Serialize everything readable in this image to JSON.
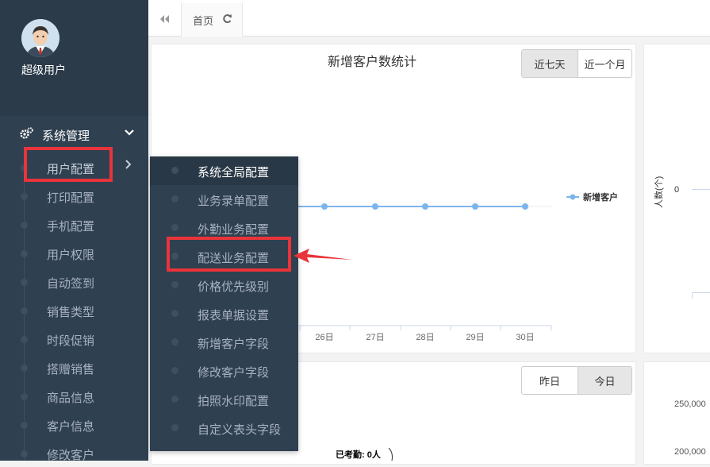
{
  "profile": {
    "name": "超级用户"
  },
  "nav": {
    "section": "系统管理",
    "items": [
      "用户配置",
      "打印配置",
      "手机配置",
      "用户权限",
      "自动签到",
      "销售类型",
      "时段促销",
      "搭赠销售",
      "商品信息",
      "客户信息",
      "修改客户"
    ]
  },
  "submenu": {
    "items": [
      "系统全局配置",
      "业务录单配置",
      "外勤业务配置",
      "配送业务配置",
      "价格优先级别",
      "报表单据设置",
      "新增客户字段",
      "修改客户字段",
      "拍照水印配置",
      "自定义表头字段"
    ]
  },
  "tabs": {
    "home": "首页"
  },
  "chart1": {
    "title": "新增客户数统计",
    "btn_week": "近七天",
    "btn_month": "近一个月",
    "legend": "新增客户",
    "x_labels": [
      "26日",
      "27日",
      "28日",
      "29日",
      "30日"
    ]
  },
  "chart_data": {
    "type": "line",
    "title": "新增客户数统计",
    "categories": [
      "26日",
      "27日",
      "28日",
      "29日",
      "30日"
    ],
    "series": [
      {
        "name": "新增客户",
        "values": [
          0,
          0,
          0,
          0,
          0
        ]
      }
    ]
  },
  "right_panel": {
    "ylabel": "人数(个)",
    "zero": "0"
  },
  "panel2": {
    "btn_yesterday": "昨日",
    "btn_today": "今日",
    "note": "已考勤: 0人"
  },
  "right_panel2": {
    "ticks": [
      "250,000",
      "200,000"
    ]
  },
  "colors": {
    "sidebar": "#2f4050",
    "highlight": "#e8343a",
    "series": "#7cb5ec"
  }
}
